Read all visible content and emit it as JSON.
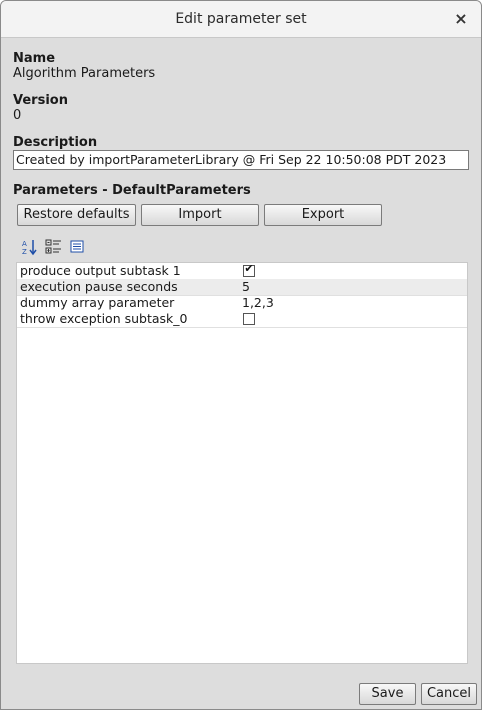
{
  "window": {
    "title": "Edit parameter set",
    "close_glyph": "×"
  },
  "name": {
    "label": "Name",
    "value": "Algorithm Parameters"
  },
  "version": {
    "label": "Version",
    "value": "0"
  },
  "description": {
    "label": "Description",
    "value": "Created by importParameterLibrary @ Fri Sep 22 10:50:08 PDT 2023"
  },
  "parameters": {
    "heading": "Parameters - DefaultParameters",
    "buttons": {
      "restore": "Restore defaults",
      "import": "Import",
      "export": "Export"
    },
    "toolbar_icons": [
      "sort-alphabetical-icon",
      "categorized-view-icon",
      "description-toggle-icon"
    ],
    "rows": [
      {
        "name": "produce output subtask 1",
        "type": "checkbox",
        "checked": true,
        "value": ""
      },
      {
        "name": "execution pause seconds",
        "type": "text",
        "checked": false,
        "value": "5"
      },
      {
        "name": "dummy array parameter",
        "type": "text",
        "checked": false,
        "value": "1,2,3"
      },
      {
        "name": "throw exception subtask_0",
        "type": "checkbox",
        "checked": false,
        "value": ""
      }
    ]
  },
  "footer": {
    "save": "Save",
    "cancel": "Cancel"
  },
  "colors": {
    "dialog_bg": "#dddddd",
    "titlebar_bg": "#f3f3f3",
    "table_bg": "#ffffff",
    "alt_row_bg": "#ececec",
    "icon_blue": "#1f4fa8"
  }
}
